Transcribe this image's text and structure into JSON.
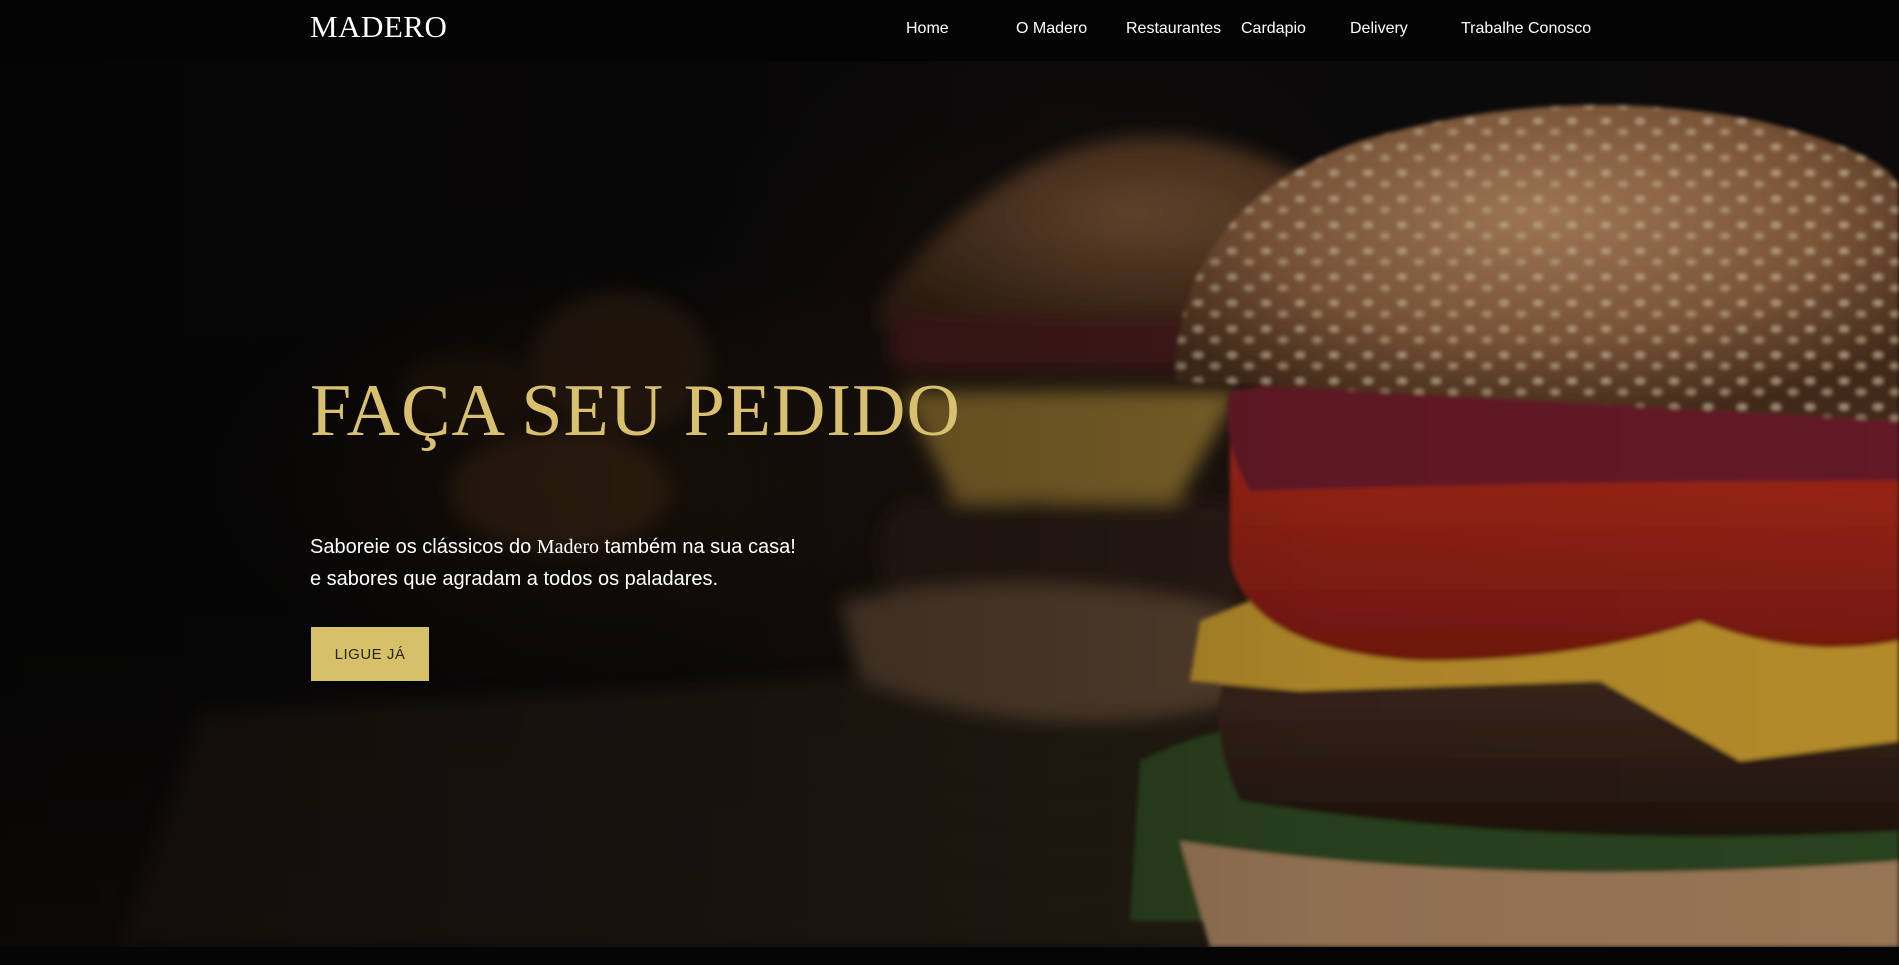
{
  "navbar": {
    "brand": "MADERO",
    "items": [
      {
        "label": "Home"
      },
      {
        "label": "O Madero"
      },
      {
        "label": "Restaurantes"
      },
      {
        "label": "Cardapio"
      },
      {
        "label": "Delivery"
      },
      {
        "label": "Trabalhe Conosco"
      }
    ]
  },
  "hero": {
    "title": "FAÇA SEU PEDIDO",
    "subtitle_part1": "Saboreie os clássicos do ",
    "subtitle_brand": "Madero",
    "subtitle_part2": " também na sua casa!",
    "subtitle_line2": "e sabores que agradam a todos os paladares.",
    "cta_label": "LIGUE JÁ",
    "background_image": "burger-photo"
  },
  "colors": {
    "accent_gold": "#d8c06e",
    "button_gold": "#d6c068",
    "nav_bg": "#040404",
    "text_light": "#ffffff"
  }
}
